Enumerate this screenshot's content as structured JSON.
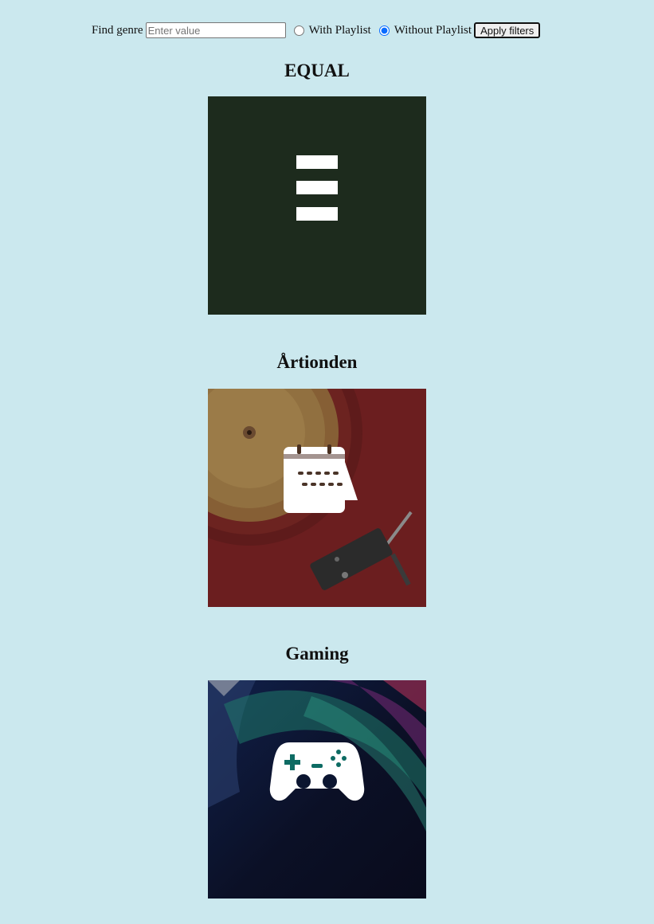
{
  "filter": {
    "label": "Find genre",
    "placeholder": "Enter value",
    "value": "",
    "options": [
      {
        "label": "With Playlist",
        "checked": false
      },
      {
        "label": "Without Playlist",
        "checked": true
      }
    ],
    "apply_label": "Apply filters"
  },
  "genres": [
    {
      "title": "EQUAL",
      "icon": "equal-icon",
      "background": "#1d2b1d"
    },
    {
      "title": "Årtionden",
      "icon": "calendar-icon",
      "background": "#6b1e1f"
    },
    {
      "title": "Gaming",
      "icon": "gamepad-icon",
      "background": "#0c1128"
    }
  ]
}
